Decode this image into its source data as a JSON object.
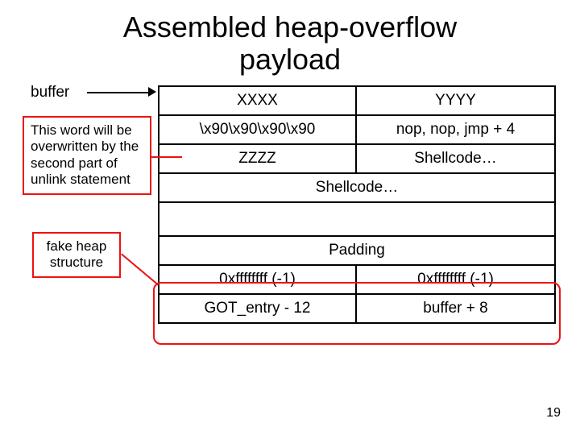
{
  "title": {
    "line1": "Assembled heap-overflow",
    "line2": "payload"
  },
  "labels": {
    "buffer": "buffer"
  },
  "notes": {
    "overwritten": "This word will be overwritten by the second part of unlink statement",
    "fake_heap": "fake heap structure"
  },
  "table": {
    "r0": {
      "left": "XXXX",
      "right": "YYYY"
    },
    "r1": {
      "left": "\\x90\\x90\\x90\\x90",
      "right": "nop, nop, jmp + 4"
    },
    "r2": {
      "left": "ZZZZ",
      "right": "Shellcode…"
    },
    "r3": {
      "full": "Shellcode…"
    },
    "gap": "",
    "r4": {
      "full": "Padding"
    },
    "r5": {
      "left": "0xffffffff (-1)",
      "right": "0xffffffff (-1)"
    },
    "r6": {
      "left": "GOT_entry - 12",
      "right": "buffer + 8"
    }
  },
  "page_number": "19",
  "chart_data": {
    "type": "table",
    "title": "Assembled heap-overflow payload",
    "rows": [
      [
        "XXXX",
        "YYYY"
      ],
      [
        "\\x90\\x90\\x90\\x90",
        "nop, nop, jmp + 4"
      ],
      [
        "ZZZZ",
        "Shellcode…"
      ],
      [
        "Shellcode…"
      ],
      [
        "Padding"
      ],
      [
        "0xffffffff (-1)",
        "0xffffffff (-1)"
      ],
      [
        "GOT_entry - 12",
        "buffer + 8"
      ]
    ],
    "annotations": [
      {
        "text": "buffer",
        "points_to": "table top-left"
      },
      {
        "text": "This word will be overwritten by the second part of unlink statement",
        "points_to": "ZZZZ cell"
      },
      {
        "text": "fake heap structure",
        "points_to": "last two rows",
        "highlight": "red rounded rectangle"
      }
    ]
  }
}
